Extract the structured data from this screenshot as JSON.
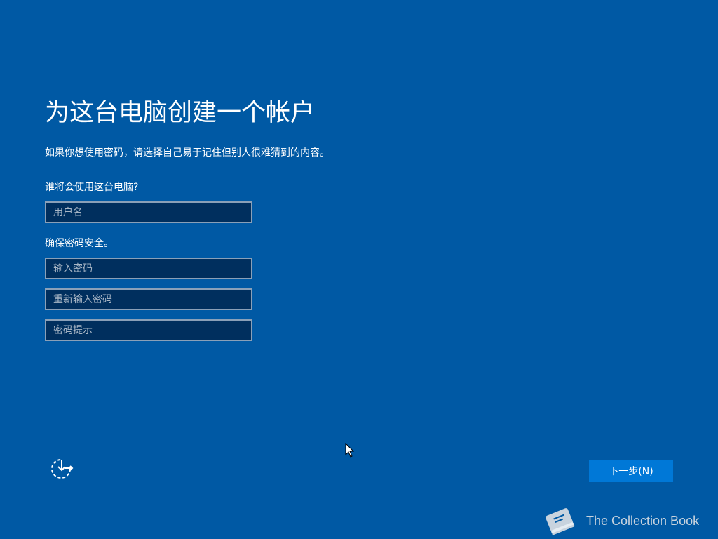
{
  "title": "为这台电脑创建一个帐户",
  "subtitle": "如果你想使用密码，请选择自己易于记住但别人很难猜到的内容。",
  "user_section": {
    "label": "谁将会使用这台电脑?",
    "username_placeholder": "用户名"
  },
  "password_section": {
    "label": "确保密码安全。",
    "password_placeholder": "输入密码",
    "confirm_placeholder": "重新输入密码",
    "hint_placeholder": "密码提示"
  },
  "footer": {
    "ease_of_access_icon": "ease-of-access-icon",
    "next_label": "下一步(N)"
  },
  "watermark": {
    "text": "The Collection Book"
  },
  "colors": {
    "background": "#0059a4",
    "field_background": "#002f5e",
    "field_border": "#8aa0b8",
    "button": "#0078d7"
  }
}
